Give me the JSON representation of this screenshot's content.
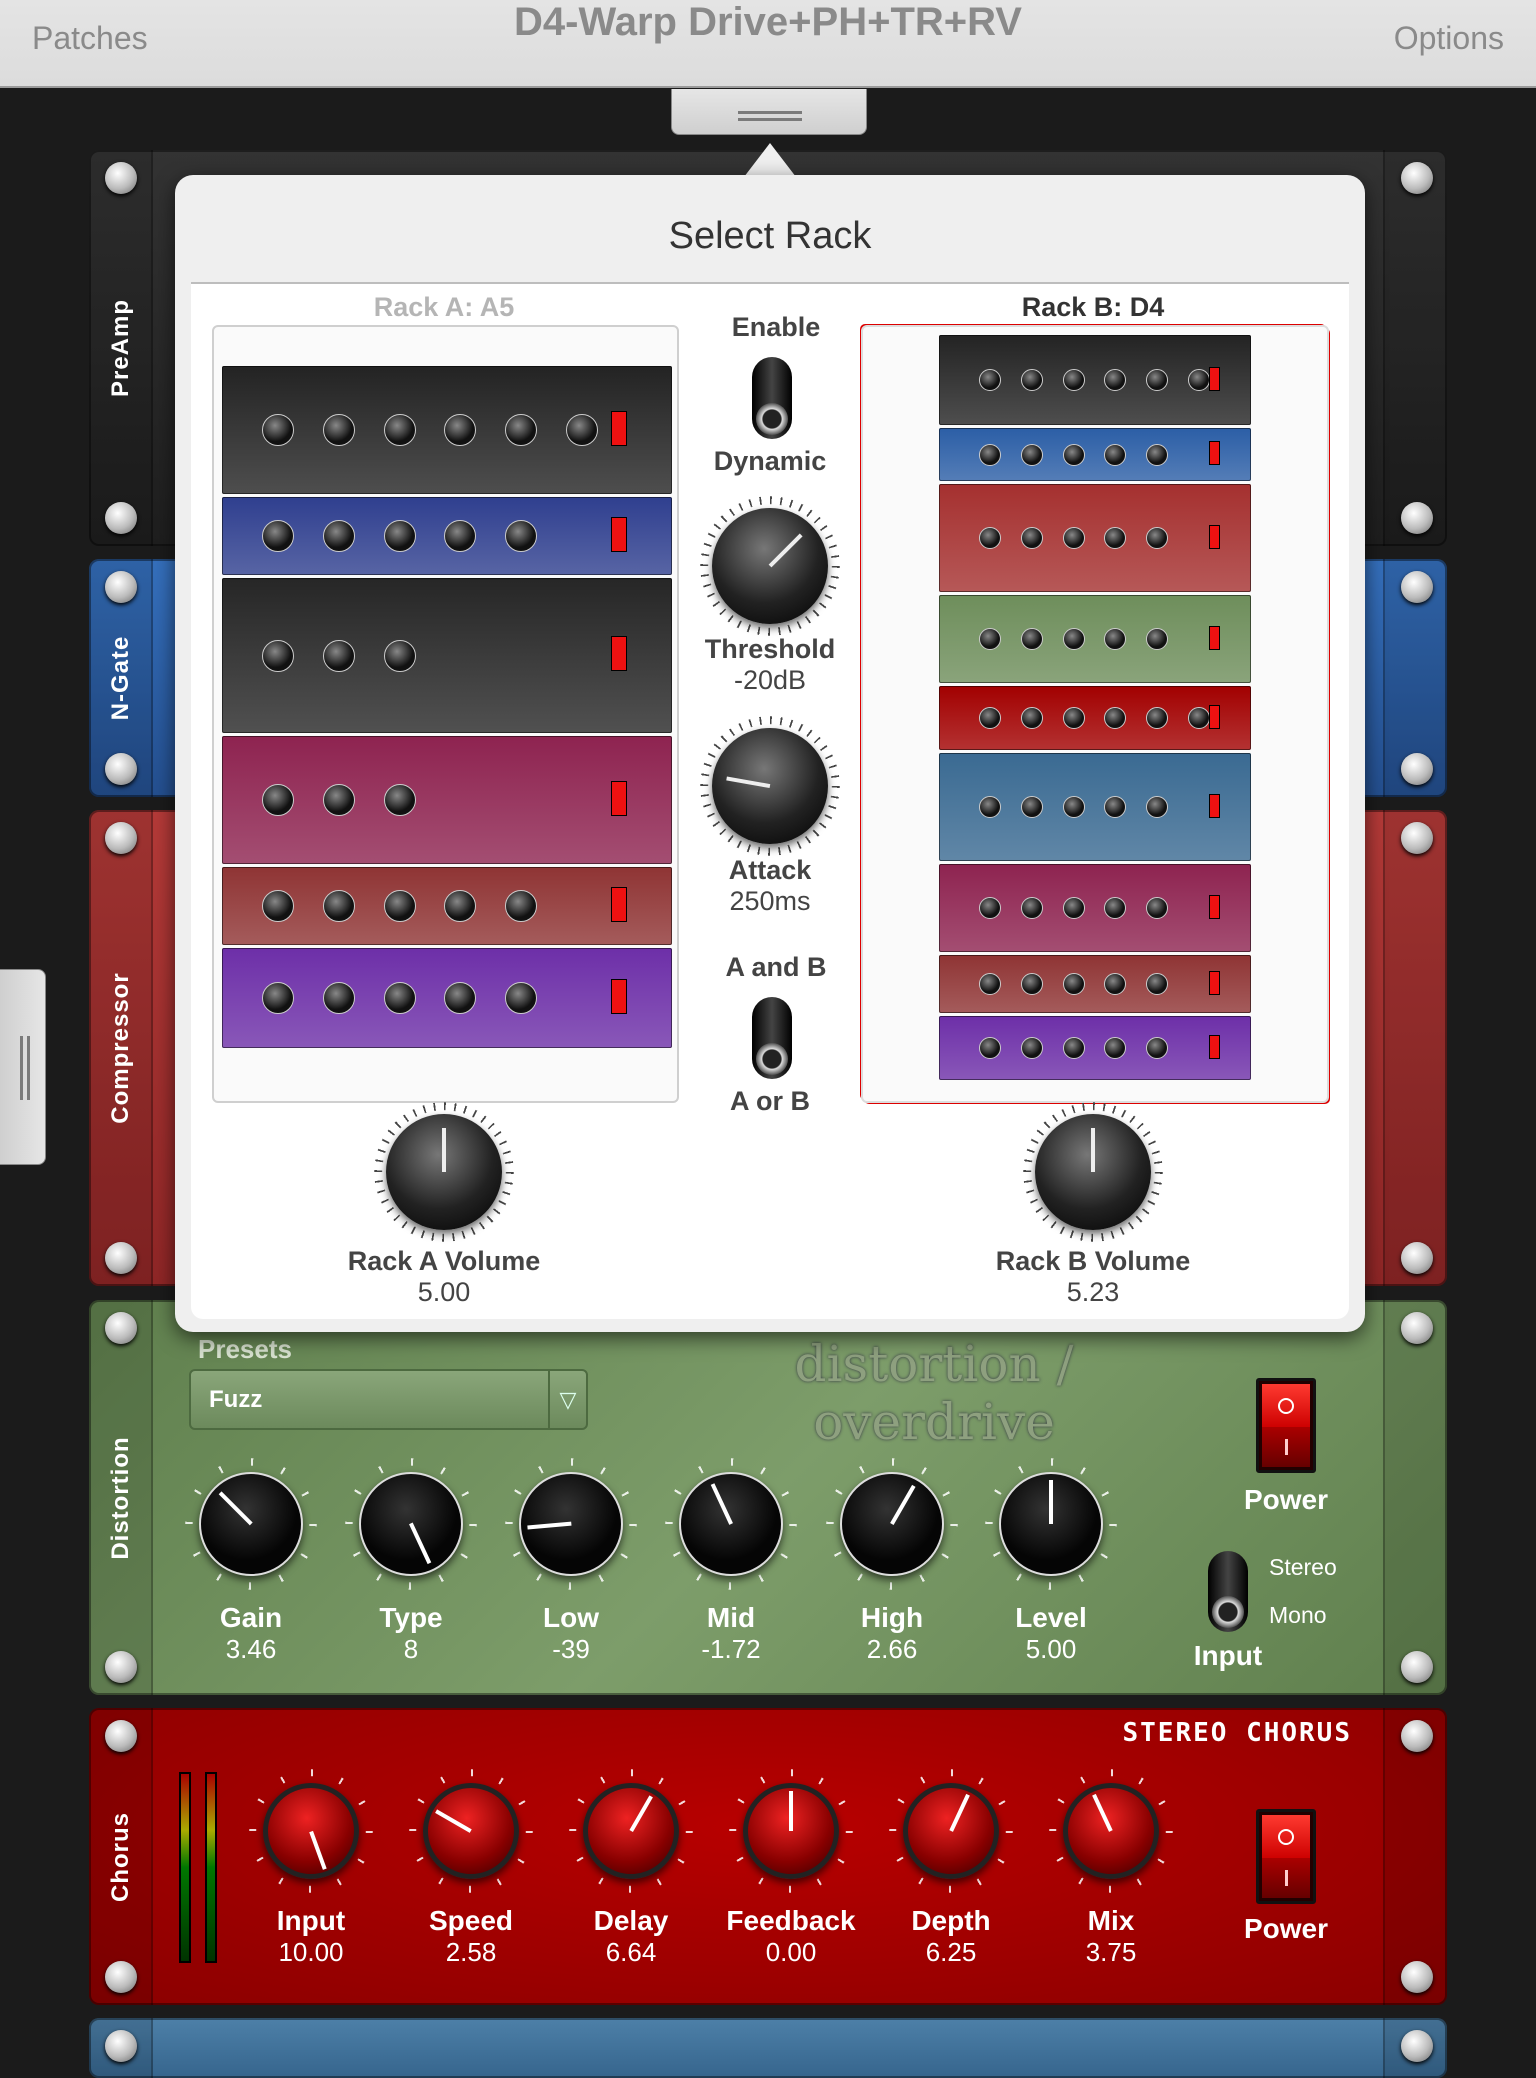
{
  "topbar": {
    "left": "Patches",
    "title": "D4-Warp Drive+PH+TR+RV",
    "right": "Options"
  },
  "modules": {
    "preamp": {
      "side": "PreAmp",
      "color": "#262626"
    },
    "ngate": {
      "side": "N-Gate",
      "color": "#2b5ea6"
    },
    "compressor": {
      "side": "Compressor",
      "color": "#a5302f"
    },
    "distortion": {
      "side": "Distortion",
      "color": "#6e8e5b",
      "presets_label": "Presets",
      "preset": "Fuzz",
      "title": "distortion / overdrive",
      "knobs": [
        {
          "label": "Gain",
          "value": "3.46"
        },
        {
          "label": "Type",
          "value": "8"
        },
        {
          "label": "Low",
          "value": "-39"
        },
        {
          "label": "Mid",
          "value": "-1.72"
        },
        {
          "label": "High",
          "value": "2.66"
        },
        {
          "label": "Level",
          "value": "5.00"
        }
      ],
      "power": "Power",
      "input_label": "Input",
      "input_options": [
        "Stereo",
        "Mono"
      ],
      "input_selected": "Mono"
    },
    "chorus": {
      "side": "Chorus",
      "color": "#a20000",
      "title": "STEREO CHORUS",
      "knobs": [
        {
          "label": "Input",
          "value": "10.00"
        },
        {
          "label": "Speed",
          "value": "2.58"
        },
        {
          "label": "Delay",
          "value": "6.64"
        },
        {
          "label": "Feedback",
          "value": "0.00"
        },
        {
          "label": "Depth",
          "value": "6.25"
        },
        {
          "label": "Mix",
          "value": "3.75"
        }
      ],
      "power": "Power"
    },
    "phaser": {
      "color": "#3a6a92"
    }
  },
  "popover": {
    "title": "Select Rack",
    "rack_a": {
      "label": "Rack A: A5",
      "volume_label": "Rack A Volume",
      "volume": "5.00",
      "modules": [
        "#232323",
        "#2f3f8f",
        "#262626",
        "#8e2350",
        "#8f3434",
        "#6d2fa8"
      ]
    },
    "rack_b": {
      "label": "Rack B: D4",
      "volume_label": "Rack B Volume",
      "volume": "5.23",
      "selected": true,
      "modules": [
        "#232323",
        "#2b5ea6",
        "#a5302f",
        "#6e8e5b",
        "#a20000",
        "#3a6a92",
        "#8e2350",
        "#8f3434",
        "#6d2fa8"
      ]
    },
    "enable_label": "Enable",
    "mode": "Dynamic",
    "threshold_label": "Threshold",
    "threshold": "-20dB",
    "attack_label": "Attack",
    "attack": "250ms",
    "combine_top": "A and B",
    "combine_bottom": "A or B",
    "combine_selected": "A or B"
  }
}
